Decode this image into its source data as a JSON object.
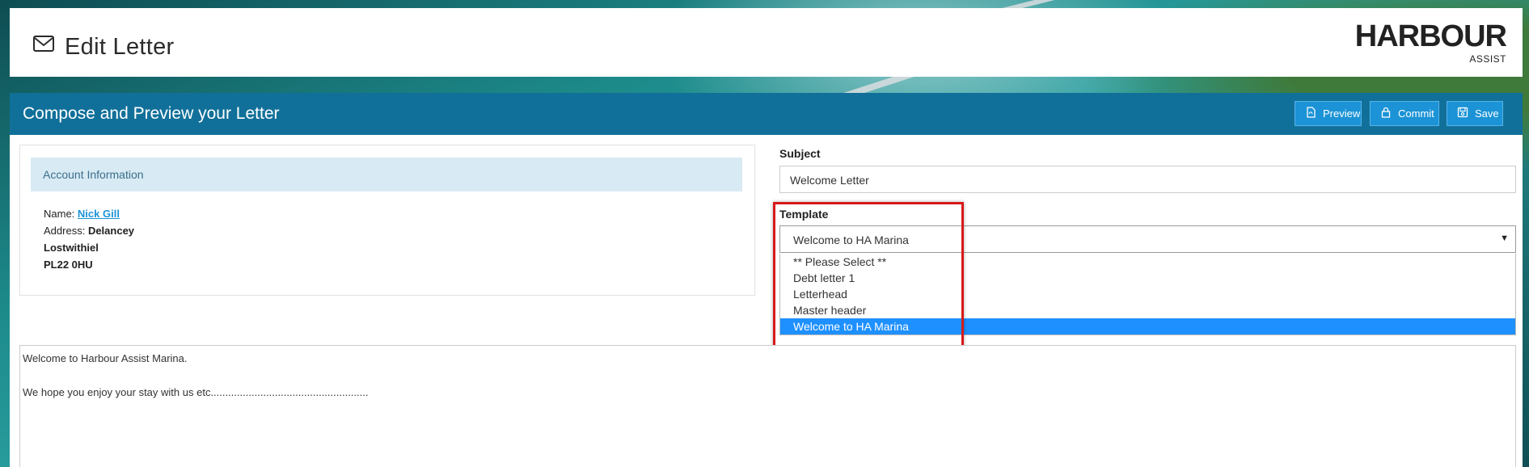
{
  "header": {
    "title": "Edit Letter",
    "logo_main": "HARBOUR",
    "logo_sub": "ASSIST"
  },
  "panel": {
    "title": "Compose and Preview your Letter",
    "buttons": {
      "preview": "Preview",
      "commit": "Commit",
      "save": "Save"
    }
  },
  "account": {
    "heading": "Account Information",
    "name_label": "Name:",
    "name_value": "Nick Gill",
    "address_label": "Address:",
    "address_lines": [
      "Delancey",
      "Lostwithiel",
      "PL22 0HU"
    ]
  },
  "subject": {
    "label": "Subject",
    "value": "Welcome Letter"
  },
  "template": {
    "label": "Template",
    "selected": "Welcome to HA Marina",
    "options": [
      "** Please Select **",
      "Debt letter 1",
      "Letterhead",
      "Master header",
      "Welcome to HA Marina"
    ],
    "selected_index": 4
  },
  "editor": {
    "lines": [
      "Welcome to Harbour Assist Marina.",
      "",
      "We hope you enjoy your stay with us etc......................................................"
    ]
  },
  "colors": {
    "panel_bar": "#11709a",
    "button": "#1b93d6",
    "highlight": "#d81a1a",
    "selected_option": "#1e90ff"
  }
}
